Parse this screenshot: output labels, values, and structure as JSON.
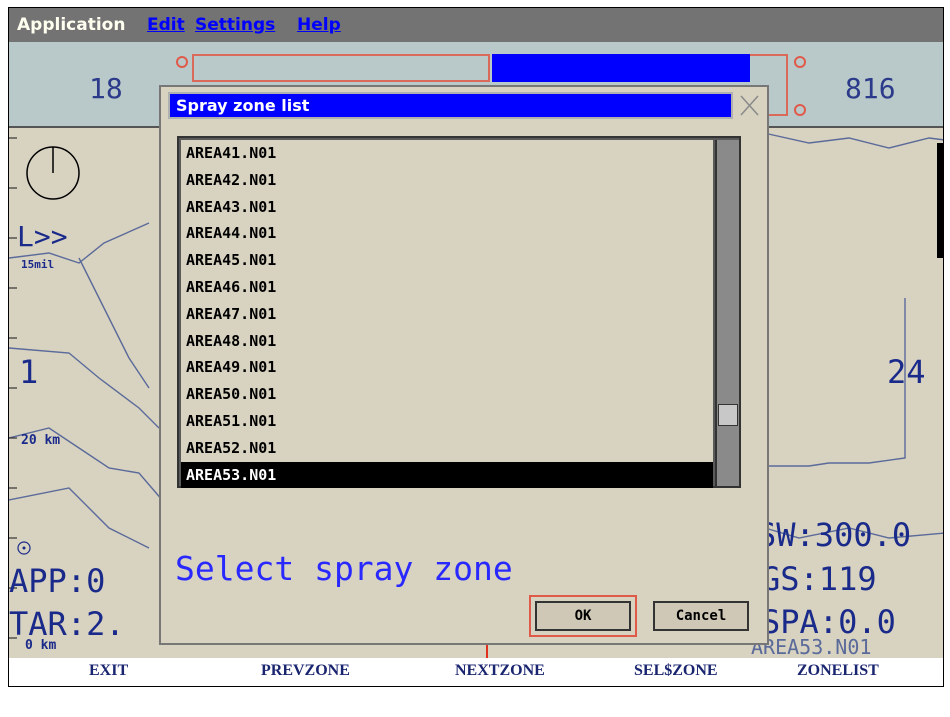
{
  "menu": {
    "items": [
      {
        "label": "Application"
      },
      {
        "label": "Edit"
      },
      {
        "label": "Settings"
      },
      {
        "label": "Help"
      }
    ]
  },
  "status": {
    "left_value": "18",
    "right_value": "816",
    "bar_fill_fraction": 0.46
  },
  "map": {
    "heading_indicator": "L>>",
    "scale_top": "15mil",
    "scale_mid": "20 km",
    "scale_bottom": "0 km",
    "left_num": "1",
    "right_num": "24",
    "app": "APP:0",
    "tar": "TAR:2.",
    "sw": "SW:300.0",
    "gs": "GS:119",
    "spa": "SPA:0.0",
    "current_zone": "AREA53.N01"
  },
  "dialog": {
    "title": "Spray zone list",
    "items": [
      "AREA41.N01",
      "AREA42.N01",
      "AREA43.N01",
      "AREA44.N01",
      "AREA45.N01",
      "AREA46.N01",
      "AREA47.N01",
      "AREA48.N01",
      "AREA49.N01",
      "AREA50.N01",
      "AREA51.N01",
      "AREA52.N01",
      "AREA53.N01"
    ],
    "selected_index": 12,
    "prompt": "Select spray zone",
    "ok_label": "OK",
    "cancel_label": "Cancel"
  },
  "fkeys": {
    "exit": "EXIT",
    "prevzone": "PREVZONE",
    "nextzone": "NEXTZONE",
    "selzone": "SEL$ZONE",
    "zonelist": "ZONELIST"
  },
  "colors": {
    "title_bar": "#0000ff",
    "accent_red": "#e05a4a",
    "text_blue": "#1a2a8a"
  }
}
